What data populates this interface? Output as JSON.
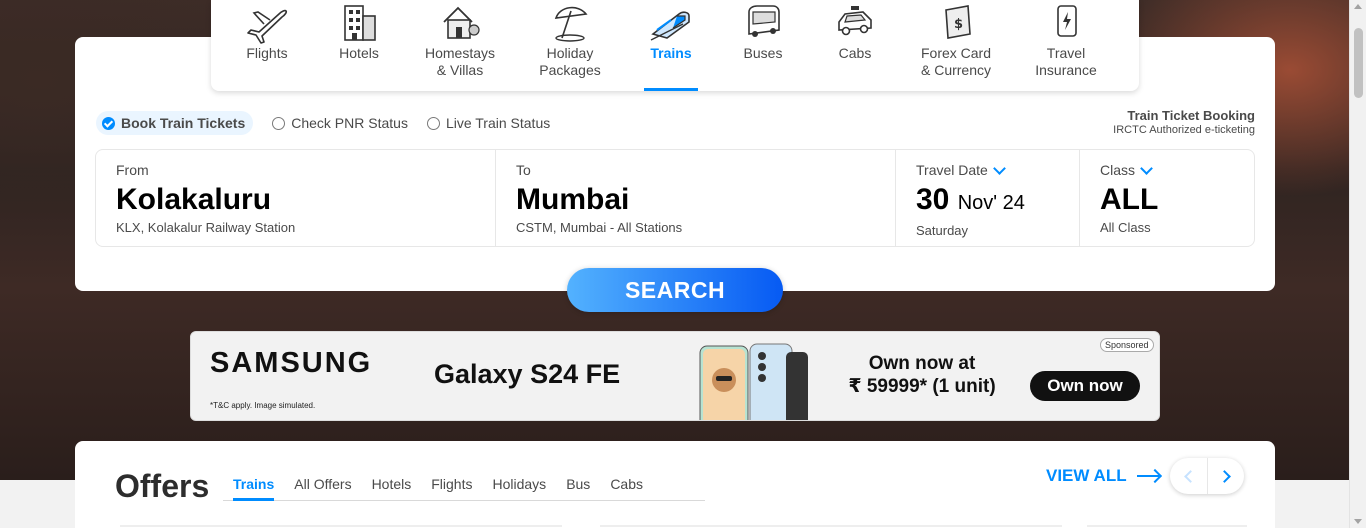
{
  "nav": {
    "items": [
      {
        "label_line1": "Flights",
        "label_line2": "",
        "icon": "airplane-icon"
      },
      {
        "label_line1": "Hotels",
        "label_line2": "",
        "icon": "hotel-building-icon"
      },
      {
        "label_line1": "Homestays",
        "label_line2": "& Villas",
        "icon": "house-icon"
      },
      {
        "label_line1": "Holiday",
        "label_line2": "Packages",
        "icon": "beach-umbrella-icon"
      },
      {
        "label_line1": "Trains",
        "label_line2": "",
        "icon": "train-icon"
      },
      {
        "label_line1": "Buses",
        "label_line2": "",
        "icon": "bus-icon"
      },
      {
        "label_line1": "Cabs",
        "label_line2": "",
        "icon": "car-icon"
      },
      {
        "label_line1": "Forex Card",
        "label_line2": "& Currency",
        "icon": "forex-card-icon"
      },
      {
        "label_line1": "Travel",
        "label_line2": "Insurance",
        "icon": "insurance-icon"
      }
    ],
    "active": "Trains"
  },
  "booking_options": {
    "book": "Book Train Tickets",
    "pnr": "Check PNR Status",
    "live": "Live Train Status",
    "selected": "Book Train Tickets"
  },
  "ttb": {
    "title": "Train Ticket Booking",
    "subtitle": "IRCTC Authorized e-ticketing"
  },
  "from": {
    "label": "From",
    "city": "Kolakaluru",
    "station": "KLX, Kolakalur Railway Station"
  },
  "to": {
    "label": "To",
    "city": "Mumbai",
    "station": "CSTM, Mumbai - All Stations"
  },
  "date": {
    "label": "Travel Date",
    "day": "30",
    "month_year": "Nov' 24",
    "weekday": "Saturday"
  },
  "class": {
    "label": "Class",
    "value": "ALL",
    "sub": "All Class"
  },
  "search_label": "SEARCH",
  "ad": {
    "brand": "SAMSUNG",
    "product": "Galaxy S24 FE",
    "offer_line1": "Own now at",
    "offer_line2": "₹ 59999* (1 unit)",
    "cta": "Own now",
    "sponsored": "Sponsored",
    "disclaimer": "*T&C apply. Image simulated."
  },
  "offers": {
    "title": "Offers",
    "tabs": [
      "Trains",
      "All Offers",
      "Hotels",
      "Flights",
      "Holidays",
      "Bus",
      "Cabs"
    ],
    "active_tab": "Trains",
    "view_all": "VIEW ALL"
  },
  "colors": {
    "accent": "#008cff",
    "search_start": "#53b2fe",
    "search_end": "#065af3"
  }
}
